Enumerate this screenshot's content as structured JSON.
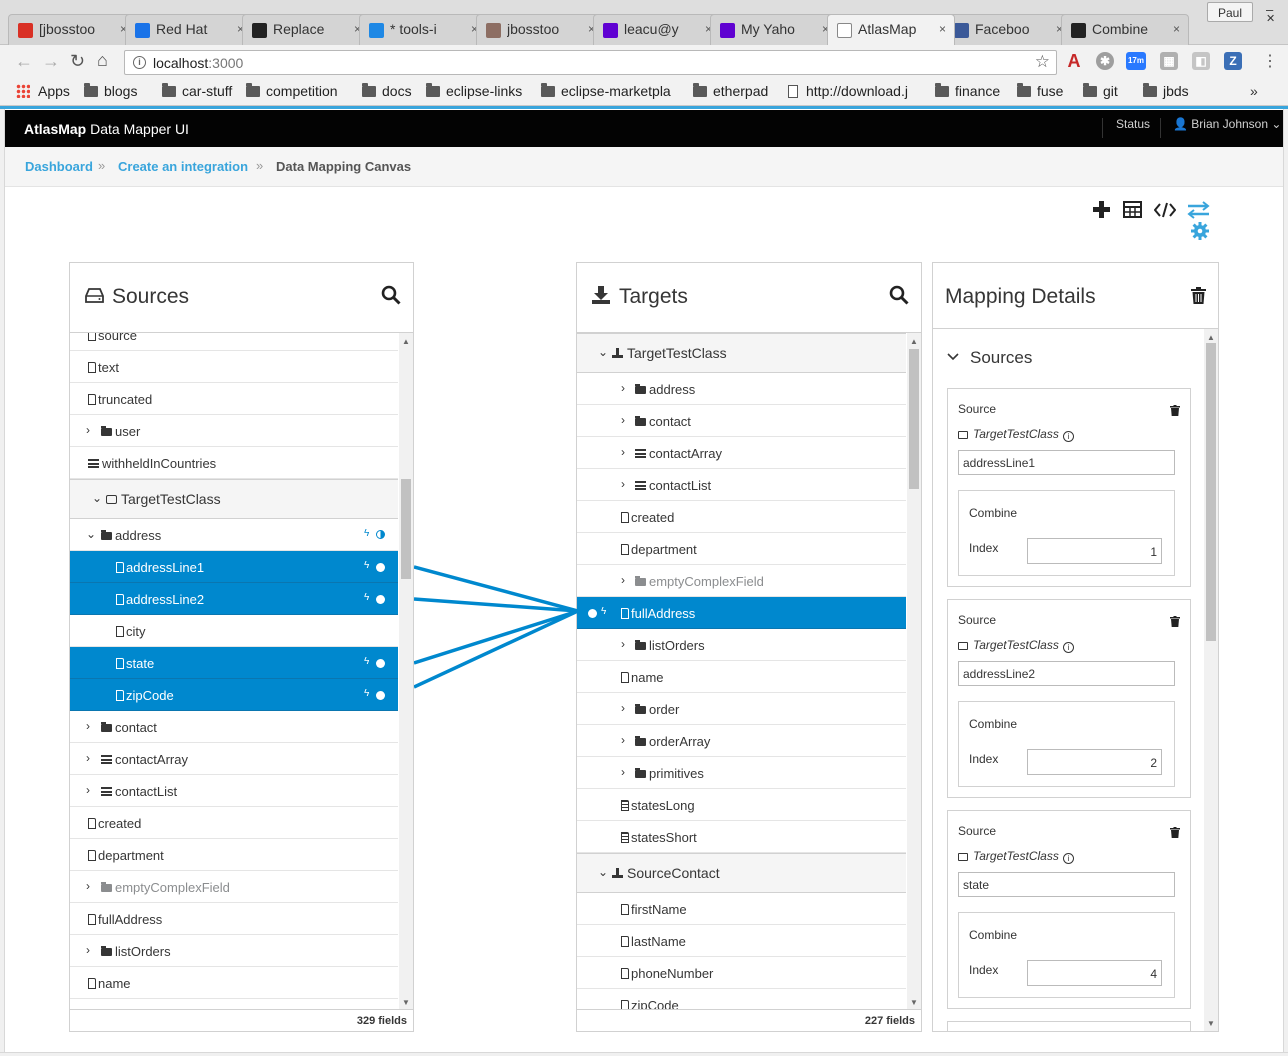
{
  "browser": {
    "tabs": [
      {
        "label": "[jbosstoo",
        "color": "#d93025",
        "icon": "gmail-icon"
      },
      {
        "label": "Red Hat",
        "color": "#1a73e8",
        "icon": "calendar-icon"
      },
      {
        "label": "Replace",
        "color": "#222222",
        "icon": "github-icon"
      },
      {
        "label": "* tools-i",
        "color": "#1e88e5",
        "icon": "timer-icon"
      },
      {
        "label": "jbosstoo",
        "color": "#8d6e63",
        "icon": "jenkins-icon"
      },
      {
        "label": "leacu@y",
        "color": "#6001d2",
        "icon": "mail-icon"
      },
      {
        "label": "My Yaho",
        "color": "#5f01d1",
        "icon": "yahoo-icon"
      },
      {
        "label": "AtlasMap",
        "color": "#ffffff",
        "icon": "page-icon",
        "active": true
      },
      {
        "label": "Faceboo",
        "color": "#3b5998",
        "icon": "facebook-icon"
      },
      {
        "label": "Combine",
        "color": "#222222",
        "icon": "github-icon"
      }
    ],
    "profile": "Paul",
    "url_host": "localhost",
    "url_port": ":3000",
    "bookmarks": [
      "Apps",
      "blogs",
      "car-stuff",
      "competition",
      "docs",
      "eclipse-links",
      "eclipse-marketpla",
      "etherpad",
      "http://download.j",
      "finance",
      "fuse",
      "git",
      "jbds"
    ],
    "ext_badge": "17m"
  },
  "app": {
    "brand_bold": "AtlasMap",
    "brand_rest": " Data Mapper UI",
    "status": "Status",
    "user": "Brian Johnson"
  },
  "breadcrumb": [
    "Dashboard",
    "Create an integration",
    "Data Mapping Canvas"
  ],
  "sources": {
    "title": "Sources",
    "footer": "329 fields",
    "rows": [
      {
        "label": "source",
        "icon": "file",
        "indent": 0,
        "partial": true
      },
      {
        "label": "text",
        "icon": "file",
        "indent": 0
      },
      {
        "label": "truncated",
        "icon": "file",
        "indent": 0
      },
      {
        "label": "user",
        "icon": "folder",
        "indent": 0,
        "chev": "right"
      },
      {
        "label": "withheldInCountries",
        "icon": "list",
        "indent": 0
      },
      {
        "label": "TargetTestClass",
        "icon": "drive",
        "group": true
      },
      {
        "label": "address",
        "icon": "folder",
        "indent": 0,
        "chev": "down",
        "mapped": "partial"
      },
      {
        "label": "addressLine1",
        "icon": "file",
        "indent": 2,
        "sel": true
      },
      {
        "label": "addressLine2",
        "icon": "file",
        "indent": 2,
        "sel": true
      },
      {
        "label": "city",
        "icon": "file",
        "indent": 2
      },
      {
        "label": "state",
        "icon": "file",
        "indent": 2,
        "sel": true
      },
      {
        "label": "zipCode",
        "icon": "file",
        "indent": 2,
        "sel": true
      },
      {
        "label": "contact",
        "icon": "folder",
        "indent": 0,
        "chev": "right"
      },
      {
        "label": "contactArray",
        "icon": "list",
        "indent": 0,
        "chev": "right"
      },
      {
        "label": "contactList",
        "icon": "list",
        "indent": 0,
        "chev": "right"
      },
      {
        "label": "created",
        "icon": "file",
        "indent": 0
      },
      {
        "label": "department",
        "icon": "file",
        "indent": 0
      },
      {
        "label": "emptyComplexField",
        "icon": "folder",
        "indent": 0,
        "chev": "right",
        "gray": true
      },
      {
        "label": "fullAddress",
        "icon": "file",
        "indent": 0
      },
      {
        "label": "listOrders",
        "icon": "folder",
        "indent": 0,
        "chev": "right"
      },
      {
        "label": "name",
        "icon": "file",
        "indent": 0
      }
    ]
  },
  "targets": {
    "title": "Targets",
    "footer": "227 fields",
    "rows": [
      {
        "label": "TargetTestClass",
        "icon": "download",
        "group": true
      },
      {
        "label": "address",
        "icon": "folder",
        "chev": "right"
      },
      {
        "label": "contact",
        "icon": "folder",
        "chev": "right"
      },
      {
        "label": "contactArray",
        "icon": "list",
        "chev": "right"
      },
      {
        "label": "contactList",
        "icon": "list",
        "chev": "right"
      },
      {
        "label": "created",
        "icon": "file"
      },
      {
        "label": "department",
        "icon": "file"
      },
      {
        "label": "emptyComplexField",
        "icon": "folder",
        "chev": "right",
        "gray": true
      },
      {
        "label": "fullAddress",
        "icon": "file",
        "sel": true
      },
      {
        "label": "listOrders",
        "icon": "folder",
        "chev": "right"
      },
      {
        "label": "name",
        "icon": "file"
      },
      {
        "label": "order",
        "icon": "folder",
        "chev": "right"
      },
      {
        "label": "orderArray",
        "icon": "folder",
        "chev": "right"
      },
      {
        "label": "primitives",
        "icon": "folder",
        "chev": "right"
      },
      {
        "label": "statesLong",
        "icon": "doc"
      },
      {
        "label": "statesShort",
        "icon": "doc"
      },
      {
        "label": "SourceContact",
        "icon": "download",
        "group": true
      },
      {
        "label": "firstName",
        "icon": "file"
      },
      {
        "label": "lastName",
        "icon": "file"
      },
      {
        "label": "phoneNumber",
        "icon": "file"
      },
      {
        "label": "zipCode",
        "icon": "file"
      }
    ]
  },
  "details": {
    "title": "Mapping Details",
    "section": "Sources",
    "source_label": "Source",
    "class_name": "TargetTestClass",
    "combine_label": "Combine",
    "index_label": "Index",
    "items": [
      {
        "field": "addressLine1",
        "index": "1"
      },
      {
        "field": "addressLine2",
        "index": "2"
      },
      {
        "field": "state",
        "index": "4"
      }
    ]
  }
}
